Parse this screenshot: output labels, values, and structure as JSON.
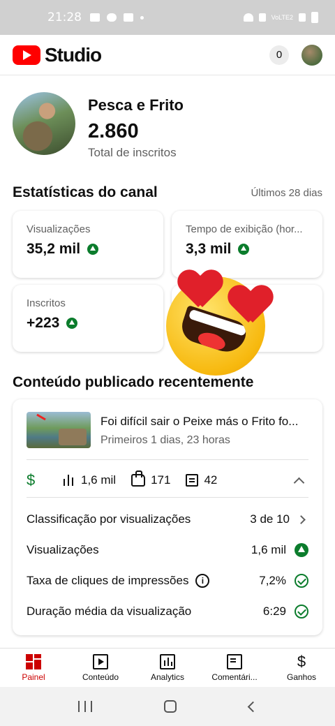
{
  "status_bar": {
    "time": "21:28",
    "carrier": "VoLTE2"
  },
  "header": {
    "app_name": "Studio",
    "notification_count": "0"
  },
  "channel": {
    "name": "Pesca e Frito",
    "subscribers": "2.860",
    "subscribers_label": "Total de inscritos"
  },
  "stats": {
    "title": "Estatísticas do canal",
    "period": "Últimos 28 dias",
    "cards": [
      {
        "label": "Visualizações",
        "value": "35,2 mil",
        "trend": "up"
      },
      {
        "label": "Tempo de exibição (hor...",
        "value": "3,3 mil",
        "trend": "up"
      },
      {
        "label": "Inscritos",
        "value": "+223",
        "trend": "up"
      }
    ]
  },
  "recent": {
    "title": "Conteúdo publicado recentemente",
    "video": {
      "title": "Foi difícil sair o Peixe más o Frito fo...",
      "age": "Primeiros 1 dias, 23 horas",
      "views": "1,6 mil",
      "likes": "171",
      "comments": "42"
    },
    "details": [
      {
        "label": "Classificação por visualizações",
        "value": "3 de 10",
        "icon": "chevron-right-icon"
      },
      {
        "label": "Visualizações",
        "value": "1,6 mil",
        "icon": "arrow-up-icon"
      },
      {
        "label": "Taxa de cliques de impressões",
        "value": "7,2%",
        "icon": "check-circle-icon",
        "info": "i"
      },
      {
        "label": "Duração média da visualização",
        "value": "6:29",
        "icon": "check-circle-icon"
      }
    ]
  },
  "bottom_nav": [
    {
      "label": "Painel",
      "active": true
    },
    {
      "label": "Conteúdo",
      "active": false
    },
    {
      "label": "Analytics",
      "active": false
    },
    {
      "label": "Comentári...",
      "active": false
    },
    {
      "label": "Ganhos",
      "active": false
    }
  ],
  "colors": {
    "brand_red": "#ff0000",
    "active_red": "#cc0000",
    "trend_green": "#0b7c2c"
  }
}
